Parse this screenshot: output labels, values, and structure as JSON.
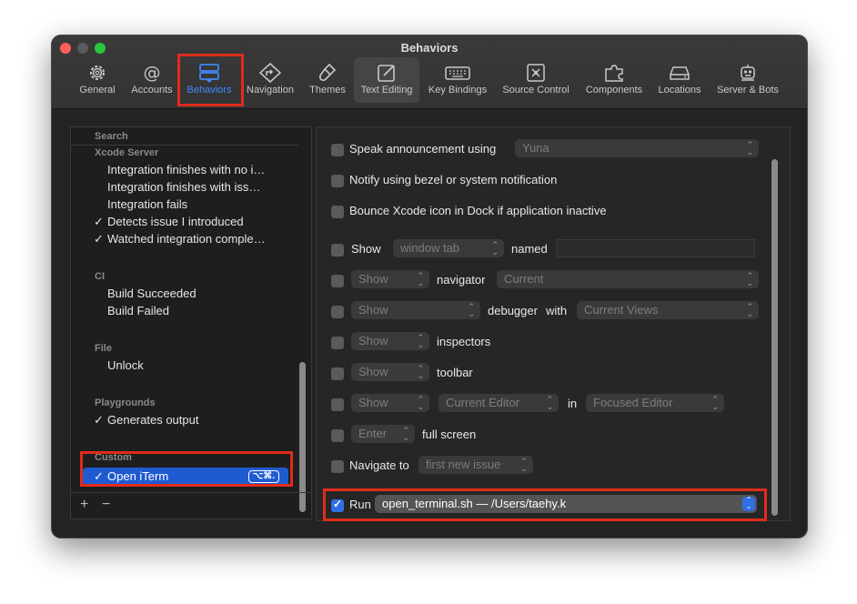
{
  "window": {
    "title": "Behaviors"
  },
  "toolbar": {
    "tabs": [
      {
        "label": "General",
        "icon": "gear-icon"
      },
      {
        "label": "Accounts",
        "icon": "at-sign-icon"
      },
      {
        "label": "Behaviors",
        "icon": "behaviors-icon",
        "selected": true
      },
      {
        "label": "Navigation",
        "icon": "navigation-icon"
      },
      {
        "label": "Themes",
        "icon": "paintbrush-icon"
      },
      {
        "label": "Text Editing",
        "icon": "text-editing-icon"
      },
      {
        "label": "Key Bindings",
        "icon": "keyboard-icon"
      },
      {
        "label": "Source Control",
        "icon": "source-control-icon"
      },
      {
        "label": "Components",
        "icon": "puzzle-icon"
      },
      {
        "label": "Locations",
        "icon": "drive-icon"
      },
      {
        "label": "Server & Bots",
        "icon": "robot-icon"
      }
    ]
  },
  "sidebar": {
    "groups": {
      "search": "Search",
      "xcode_server": "Xcode Server",
      "ci": "CI",
      "file": "File",
      "playgrounds": "Playgrounds",
      "custom": "Custom"
    },
    "items": {
      "int_no_issues": "Integration finishes with no i…",
      "int_issues": "Integration finishes with iss…",
      "int_fails": "Integration fails",
      "detects_issue": "Detects issue I introduced",
      "watched_integration": "Watched integration comple…",
      "build_succeeded": "Build Succeeded",
      "build_failed": "Build Failed",
      "unlock": "Unlock",
      "generates_output": "Generates output",
      "open_iterm": "Open iTerm",
      "open_iterm_shortcut": "⌥⌘."
    },
    "check_mark": "✓",
    "add_label": "+",
    "remove_label": "−"
  },
  "settings": {
    "speak_label": "Speak announcement using",
    "speak_voice": "Yuna",
    "notify_label": "Notify using bezel or system notification",
    "bounce_label": "Bounce Xcode icon in Dock if application inactive",
    "show_label": "Show",
    "show_in": "window tab",
    "named_label": "named",
    "named_value": "",
    "nav_show": "Show",
    "navigator_label": "navigator",
    "navigator_value": "Current",
    "debugger_show": "Show",
    "debugger_label": "debugger",
    "with_label": "with",
    "debugger_views": "Current Views",
    "inspectors_show": "Show",
    "inspectors_label": "inspectors",
    "toolbar_show": "Show",
    "toolbar_label": "toolbar",
    "editor_show": "Show",
    "editor_value": "Current Editor",
    "in_label": "in",
    "editor_target": "Focused Editor",
    "fullscreen_value": "Enter",
    "fullscreen_label": "full screen",
    "navigate_label": "Navigate to",
    "navigate_value": "first new issue",
    "run_label": "Run",
    "run_value": "open_terminal.sh — /Users/taehy.k",
    "run_checked": true
  },
  "colors": {
    "accent": "#3d8bfd",
    "selection": "#1f5bd0",
    "highlight_box": "#e02c1b"
  }
}
